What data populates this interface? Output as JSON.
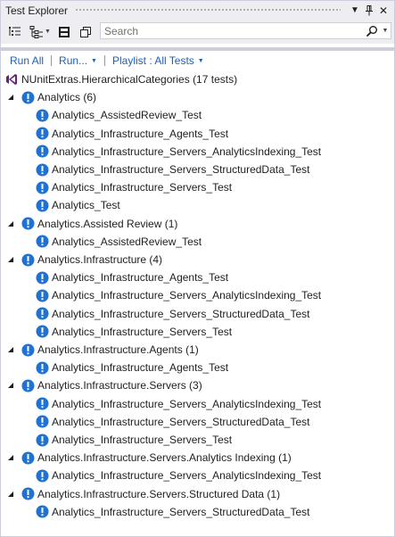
{
  "window": {
    "title": "Test Explorer"
  },
  "search": {
    "placeholder": "Search"
  },
  "commands": {
    "run_all": "Run All",
    "run": "Run...",
    "playlist": "Playlist : All Tests"
  },
  "root": {
    "label": "NUnitExtras.HierarchicalCategories (17 tests)"
  },
  "groups": [
    {
      "label": "Analytics (6)",
      "tests": [
        "Analytics_AssistedReview_Test",
        "Analytics_Infrastructure_Agents_Test",
        "Analytics_Infrastructure_Servers_AnalyticsIndexing_Test",
        "Analytics_Infrastructure_Servers_StructuredData_Test",
        "Analytics_Infrastructure_Servers_Test",
        "Analytics_Test"
      ]
    },
    {
      "label": "Analytics.Assisted Review (1)",
      "tests": [
        "Analytics_AssistedReview_Test"
      ]
    },
    {
      "label": "Analytics.Infrastructure (4)",
      "tests": [
        "Analytics_Infrastructure_Agents_Test",
        "Analytics_Infrastructure_Servers_AnalyticsIndexing_Test",
        "Analytics_Infrastructure_Servers_StructuredData_Test",
        "Analytics_Infrastructure_Servers_Test"
      ]
    },
    {
      "label": "Analytics.Infrastructure.Agents (1)",
      "tests": [
        "Analytics_Infrastructure_Agents_Test"
      ]
    },
    {
      "label": "Analytics.Infrastructure.Servers (3)",
      "tests": [
        "Analytics_Infrastructure_Servers_AnalyticsIndexing_Test",
        "Analytics_Infrastructure_Servers_StructuredData_Test",
        "Analytics_Infrastructure_Servers_Test"
      ]
    },
    {
      "label": "Analytics.Infrastructure.Servers.Analytics Indexing (1)",
      "tests": [
        "Analytics_Infrastructure_Servers_AnalyticsIndexing_Test"
      ]
    },
    {
      "label": "Analytics.Infrastructure.Servers.Structured Data (1)",
      "tests": [
        "Analytics_Infrastructure_Servers_StructuredData_Test"
      ]
    }
  ],
  "colors": {
    "accent": "#1e5fb5",
    "info_icon": "#1e72d6",
    "vs_purple": "#68217a"
  },
  "icons": {
    "group_by": "group-by-icon",
    "hierarchy": "hierarchy-icon",
    "run_tests": "run-tests-icon",
    "copy": "copy-icon",
    "search": "search-icon",
    "pin": "pin-icon",
    "dropdown": "window-menu-icon",
    "close": "close-icon",
    "not_run": "info-icon",
    "expanded": "expanded-triangle-icon",
    "vs_project": "vs-project-icon"
  }
}
